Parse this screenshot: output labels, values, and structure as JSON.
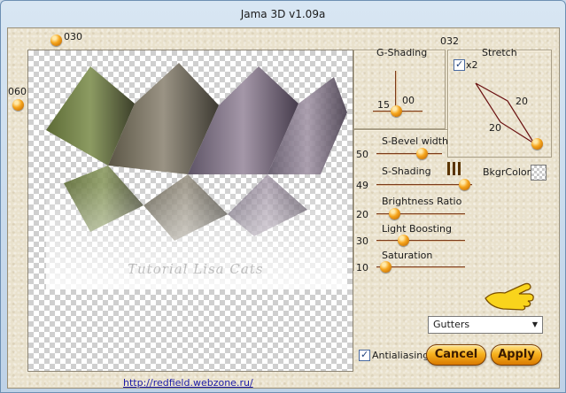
{
  "window": {
    "title": "Jama 3D v1.09a"
  },
  "preview": {
    "watermark": "Tutorial Lisa Cats"
  },
  "controls": {
    "ball_top_label": "030",
    "ball_left_label": "060",
    "label_032": "032"
  },
  "g_shading": {
    "title": "G-Shading",
    "value_h": "15",
    "value_v": "00"
  },
  "stretch": {
    "title": "Stretch",
    "x2_label": "x2",
    "x2_checked": true,
    "value_top": "20",
    "value_bottom": "20"
  },
  "sliders": [
    {
      "label": "S-Bevel width",
      "value": "50"
    },
    {
      "label": "S-Shading",
      "value": "49"
    },
    {
      "label": "Brightness Ratio",
      "value": "20"
    },
    {
      "label": "Light Boosting",
      "value": "30"
    },
    {
      "label": "Saturation",
      "value": "10"
    }
  ],
  "bkgr": {
    "label": "BkgrColor:"
  },
  "preset": {
    "selected": "Gutters"
  },
  "antialiasing": {
    "label": "Antialiasing",
    "checked": true
  },
  "buttons": {
    "cancel": "Cancel",
    "apply": "Apply"
  },
  "footer": {
    "link": "http://redfield.webzone.ru/"
  },
  "colors": {
    "accent": "#f6a51c",
    "track": "#7a3a1a",
    "client_bg": "#e9e1cc"
  }
}
